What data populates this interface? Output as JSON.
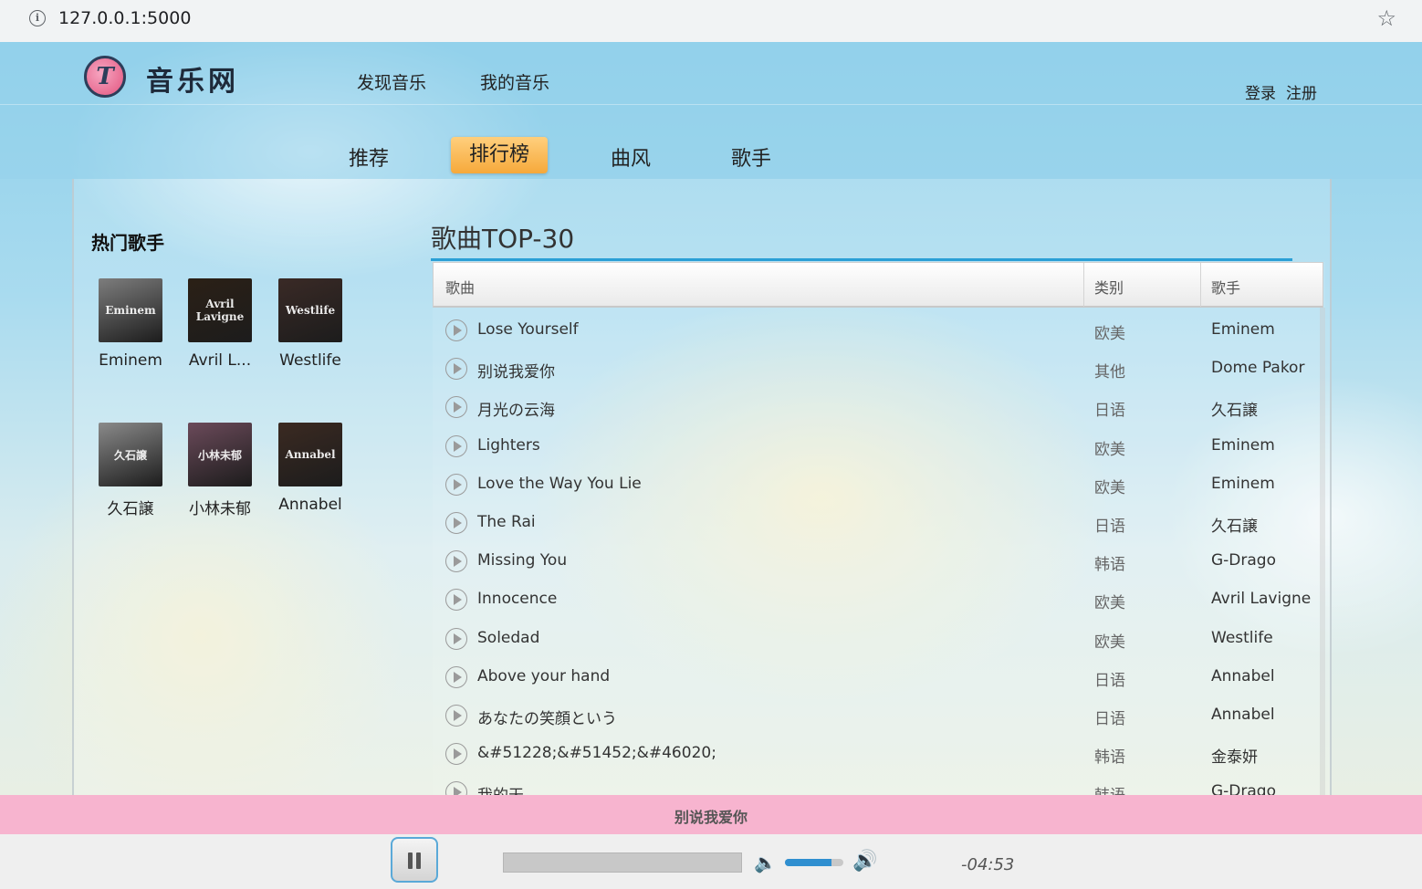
{
  "browser": {
    "url": "127.0.0.1:5000"
  },
  "header": {
    "site_name": "音乐网",
    "nav": [
      "发现音乐",
      "我的音乐"
    ],
    "auth": {
      "login": "登录",
      "register": "注册"
    },
    "subnav": [
      "推荐",
      "排行榜",
      "曲风",
      "歌手"
    ],
    "active_subnav": "排行榜"
  },
  "sidebar": {
    "title": "热门歌手",
    "artists": [
      {
        "name": "Eminem",
        "thumb_text": "Eminem",
        "color": "#7d7d7d"
      },
      {
        "name": "Avril L...",
        "thumb_text": "Avril Lavigne",
        "color": "#2b2016"
      },
      {
        "name": "Westlife",
        "thumb_text": "Westlife",
        "color": "#3a2a26"
      },
      {
        "name": "久石譲",
        "thumb_text": "久石譲",
        "color": "#8a8a8a"
      },
      {
        "name": "小林未郁",
        "thumb_text": "小林未郁",
        "color": "#6b4a5a"
      },
      {
        "name": "Annabel",
        "thumb_text": "Annabel",
        "color": "#3b2a22"
      }
    ]
  },
  "chart": {
    "title": "歌曲TOP-30",
    "columns": {
      "song": "歌曲",
      "category": "类别",
      "singer": "歌手"
    },
    "rows": [
      {
        "song": "Lose Yourself",
        "category": "欧美",
        "singer": "Eminem"
      },
      {
        "song": "别说我爱你",
        "category": "其他",
        "singer": "Dome Pakor"
      },
      {
        "song": "月光の云海",
        "category": "日语",
        "singer": "久石譲"
      },
      {
        "song": "Lighters",
        "category": "欧美",
        "singer": "Eminem"
      },
      {
        "song": "Love the Way You Lie",
        "category": "欧美",
        "singer": "Eminem"
      },
      {
        "song": "The Rai",
        "category": "日语",
        "singer": "久石譲"
      },
      {
        "song": "Missing You",
        "category": "韩语",
        "singer": "G-Drago"
      },
      {
        "song": "Innocence",
        "category": "欧美",
        "singer": "Avril Lavigne"
      },
      {
        "song": "Soledad",
        "category": "欧美",
        "singer": "Westlife"
      },
      {
        "song": "Above your hand",
        "category": "日语",
        "singer": "Annabel"
      },
      {
        "song": "あなたの笑顔という",
        "category": "日语",
        "singer": "Annabel"
      },
      {
        "song": "&#51228;&#51452;&#46020;",
        "category": "韩语",
        "singer": "金泰妍"
      },
      {
        "song": "我的天",
        "category": "韩语",
        "singer": "G-Drago"
      }
    ]
  },
  "player": {
    "now_playing": "别说我爱你",
    "time_remaining": "-04:53",
    "progress_fraction": 0.0,
    "volume_fraction": 0.8
  },
  "colors": {
    "accent": "#2a9fd6",
    "active_tab": "#f6a93b",
    "player_bar": "#f7b4cf"
  }
}
